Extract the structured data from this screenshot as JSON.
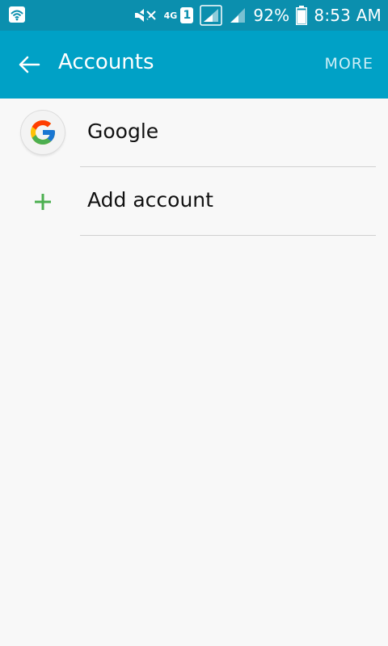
{
  "status_bar": {
    "network_label": "4G",
    "sim_slot": "1",
    "battery_percent": "92%",
    "battery_level": 0.92,
    "time": "8:53 AM"
  },
  "app_bar": {
    "title": "Accounts",
    "more_label": "MORE"
  },
  "accounts": {
    "items": [
      {
        "label": "Google",
        "icon": "google-logo-icon"
      },
      {
        "label": "Add account",
        "icon": "plus-icon"
      }
    ]
  },
  "colors": {
    "status_bar_bg": "#0b8fae",
    "app_bar_bg": "#00a1c6",
    "add_icon": "#4caf50"
  }
}
